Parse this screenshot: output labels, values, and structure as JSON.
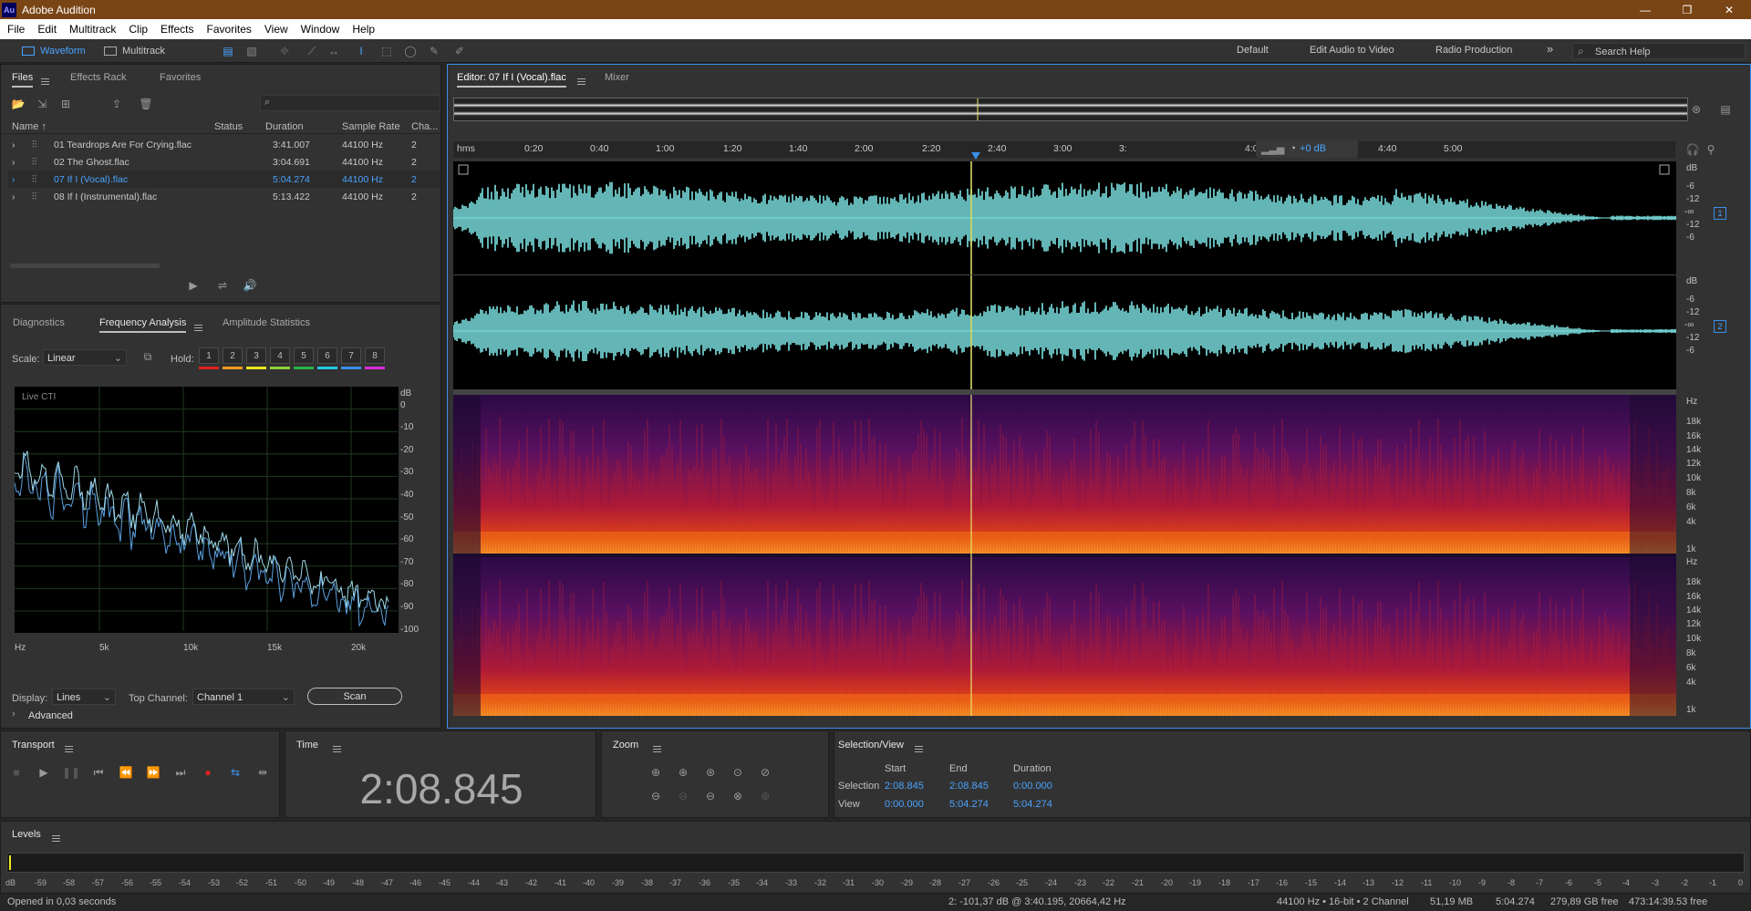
{
  "app": {
    "title": "Adobe Audition",
    "logo": "Au"
  },
  "window_controls": {
    "minimize": "—",
    "maximize": "❐",
    "close": "✕"
  },
  "menu": [
    "File",
    "Edit",
    "Multitrack",
    "Clip",
    "Effects",
    "Favorites",
    "View",
    "Window",
    "Help"
  ],
  "toolbar": {
    "waveform": "Waveform",
    "multitrack": "Multitrack",
    "workspaces": [
      "Default",
      "Edit Audio to Video",
      "Radio Production"
    ],
    "more": "»",
    "search_placeholder": "Search Help"
  },
  "files_panel": {
    "tabs": [
      "Files",
      "Effects Rack",
      "Favorites"
    ],
    "columns": [
      "Name ↑",
      "Status",
      "Duration",
      "Sample Rate",
      "Cha..."
    ],
    "rows": [
      {
        "name": "01 Teardrops Are For Crying.flac",
        "duration": "3:41.007",
        "rate": "44100 Hz",
        "ch": "2",
        "selected": false
      },
      {
        "name": "02 The Ghost.flac",
        "duration": "3:04.691",
        "rate": "44100 Hz",
        "ch": "2",
        "selected": false
      },
      {
        "name": "07 If I (Vocal).flac",
        "duration": "5:04.274",
        "rate": "44100 Hz",
        "ch": "2",
        "selected": true
      },
      {
        "name": "08 If I (Instrumental).flac",
        "duration": "5:13.422",
        "rate": "44100 Hz",
        "ch": "2",
        "selected": false
      }
    ]
  },
  "analysis_panel": {
    "tabs": [
      "Diagnostics",
      "Frequency Analysis",
      "Amplitude Statistics"
    ],
    "scale_label": "Scale:",
    "scale_value": "Linear",
    "hold_label": "Hold:",
    "hold_buttons": [
      "1",
      "2",
      "3",
      "4",
      "5",
      "6",
      "7",
      "8"
    ],
    "hold_colors": [
      "#e0221e",
      "#f09a1e",
      "#e8e81e",
      "#8fd13a",
      "#29b34a",
      "#22c8e0",
      "#3a8fe8",
      "#d82bd8"
    ],
    "graph_label": "Live CTI",
    "db_ticks": [
      "dB",
      "0",
      "-10",
      "-20",
      "-30",
      "-40",
      "-50",
      "-60",
      "-70",
      "-80",
      "-90",
      "-100"
    ],
    "hz_ticks": [
      "Hz",
      "5k",
      "10k",
      "15k",
      "20k"
    ],
    "display_label": "Display:",
    "display_value": "Lines",
    "top_channel_label": "Top Channel:",
    "top_channel_value": "Channel 1",
    "scan": "Scan",
    "advanced": "Advanced"
  },
  "editor": {
    "tab": "Editor: 07 If I (Vocal).flac",
    "mixer": "Mixer",
    "ruler": [
      "hms",
      "0:20",
      "0:40",
      "1:00",
      "1:20",
      "1:40",
      "2:00",
      "2:20",
      "2:40",
      "3:00",
      "3:",
      "4:00",
      "4:20",
      "4:40",
      "5:00"
    ],
    "hud_db": "+0 dB",
    "wave_db": [
      "dB",
      "-6",
      "-12",
      "-∞",
      "-12",
      "-6"
    ],
    "channels": [
      "1",
      "2"
    ],
    "spec_hz": [
      "Hz",
      "18k",
      "16k",
      "14k",
      "12k",
      "10k",
      "8k",
      "6k",
      "4k",
      "1k"
    ],
    "colors": {
      "waveform": "#7de3e3",
      "playhead": "#e8e86a",
      "cti": "#3a8fe8"
    }
  },
  "transport": {
    "title": "Transport"
  },
  "time": {
    "title": "Time",
    "value": "2:08.845"
  },
  "zoom": {
    "title": "Zoom"
  },
  "selection": {
    "title": "Selection/View",
    "headers": [
      "Start",
      "End",
      "Duration"
    ],
    "rows": [
      {
        "label": "Selection",
        "start": "2:08.845",
        "end": "2:08.845",
        "duration": "0:00.000"
      },
      {
        "label": "View",
        "start": "0:00.000",
        "end": "5:04.274",
        "duration": "5:04.274"
      }
    ]
  },
  "levels": {
    "title": "Levels",
    "ticks": [
      "dB",
      "-59",
      "-58",
      "-57",
      "-56",
      "-55",
      "-54",
      "-53",
      "-52",
      "-51",
      "-50",
      "-49",
      "-48",
      "-47",
      "-46",
      "-45",
      "-44",
      "-43",
      "-42",
      "-41",
      "-40",
      "-39",
      "-38",
      "-37",
      "-36",
      "-35",
      "-34",
      "-33",
      "-32",
      "-31",
      "-30",
      "-29",
      "-28",
      "-27",
      "-26",
      "-25",
      "-24",
      "-23",
      "-22",
      "-21",
      "-20",
      "-19",
      "-18",
      "-17",
      "-16",
      "-15",
      "-14",
      "-13",
      "-12",
      "-11",
      "-10",
      "-9",
      "-8",
      "-7",
      "-6",
      "-5",
      "-4",
      "-3",
      "-2",
      "-1",
      "0"
    ]
  },
  "statusbar": {
    "left": "Opened in 0,03 seconds",
    "cursor": "2: -101,37 dB @ 3:40.195, 20664,42 Hz",
    "format": "44100 Hz • 16-bit • 2 Channel",
    "size": "51,19 MB",
    "duration": "5:04.274",
    "disk": "279,89 GB free",
    "time_free": "473:14:39.53 free"
  }
}
